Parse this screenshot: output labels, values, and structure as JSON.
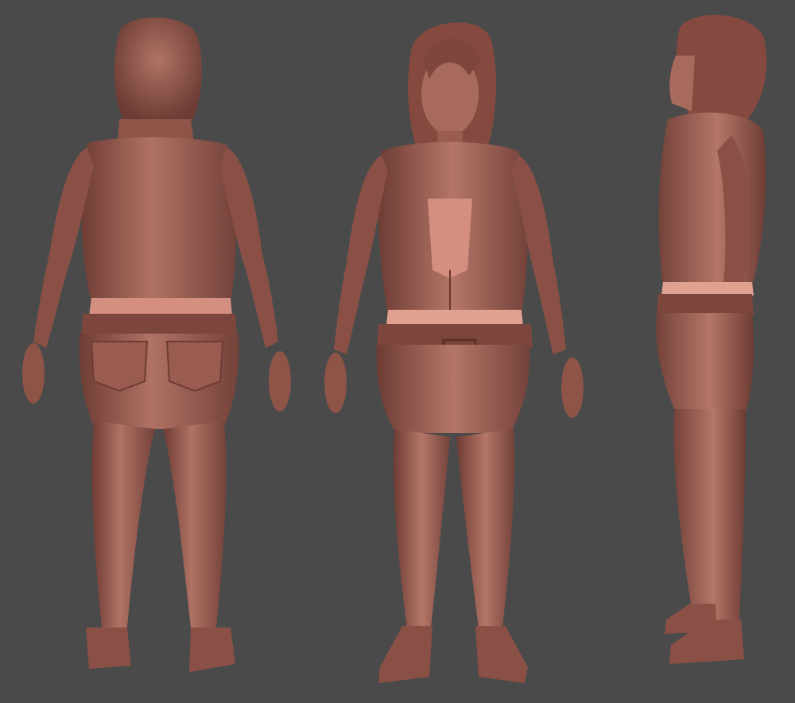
{
  "scene": {
    "views": [
      {
        "id": "back",
        "label": ""
      },
      {
        "id": "front",
        "label": ""
      },
      {
        "id": "side",
        "label": ""
      }
    ]
  },
  "colors": {
    "background": "#4a4a4a",
    "clay_base": "#9a5c50",
    "clay_light": "#b87a6c",
    "clay_dark": "#6e3c34",
    "tank_top": "#d48f80",
    "waistband": "#e0a191"
  }
}
